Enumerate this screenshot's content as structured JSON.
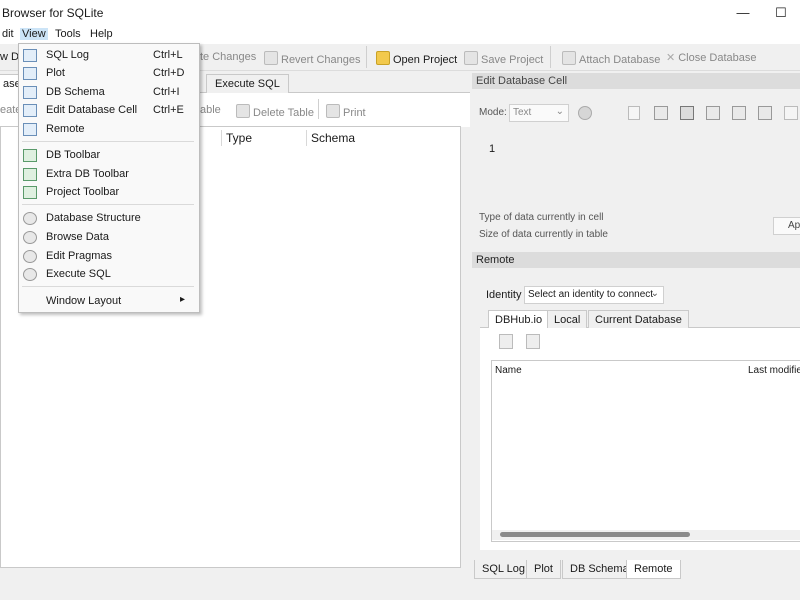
{
  "window": {
    "title": "Browser for SQLite",
    "minimize": "—",
    "maximize": "☐"
  },
  "menubar": {
    "items": [
      "dit",
      "View",
      "Tools",
      "Help"
    ]
  },
  "toolbar": {
    "new_db": "w Da",
    "write_changes": "te Changes",
    "revert_changes": "Revert Changes",
    "open_project": "Open Project",
    "save_project": "Save Project",
    "attach_database": "Attach Database",
    "close_database": "Close Database"
  },
  "left_tabs": {
    "structure": "ase S",
    "execute_sql": "Execute SQL"
  },
  "left_toolbar": {
    "create": "eate",
    "modify": "able",
    "delete_table": "Delete Table",
    "print": "Print"
  },
  "tree": {
    "columns": [
      "Type",
      "Schema"
    ]
  },
  "view_menu": {
    "items": [
      {
        "label": "SQL Log",
        "shortcut": "Ctrl+L"
      },
      {
        "label": "Plot",
        "shortcut": "Ctrl+D"
      },
      {
        "label": "DB Schema",
        "shortcut": "Ctrl+I"
      },
      {
        "label": "Edit Database Cell",
        "shortcut": "Ctrl+E"
      },
      {
        "label": "Remote",
        "shortcut": ""
      }
    ],
    "toolbars": [
      "DB Toolbar",
      "Extra DB Toolbar",
      "Project Toolbar"
    ],
    "panes": [
      "Database Structure",
      "Browse Data",
      "Edit Pragmas",
      "Execute SQL"
    ],
    "window_layout": "Window Layout",
    "submenu_arrow": "▸"
  },
  "edit_cell": {
    "title": "Edit Database Cell",
    "mode_label": "Mode:",
    "mode_value": "Text",
    "line_number": "1",
    "type_info": "Type of data currently in cell",
    "size_info": "Size of data currently in table",
    "apply": "Ap"
  },
  "remote": {
    "title": "Remote",
    "identity_label": "Identity",
    "identity_value": "Select an identity to connect",
    "tabs": [
      "DBHub.io",
      "Local",
      "Current Database"
    ],
    "columns": [
      "Name",
      "Last modified"
    ]
  },
  "bottom_tabs": [
    "SQL Log",
    "Plot",
    "DB Schema",
    "Remote"
  ]
}
